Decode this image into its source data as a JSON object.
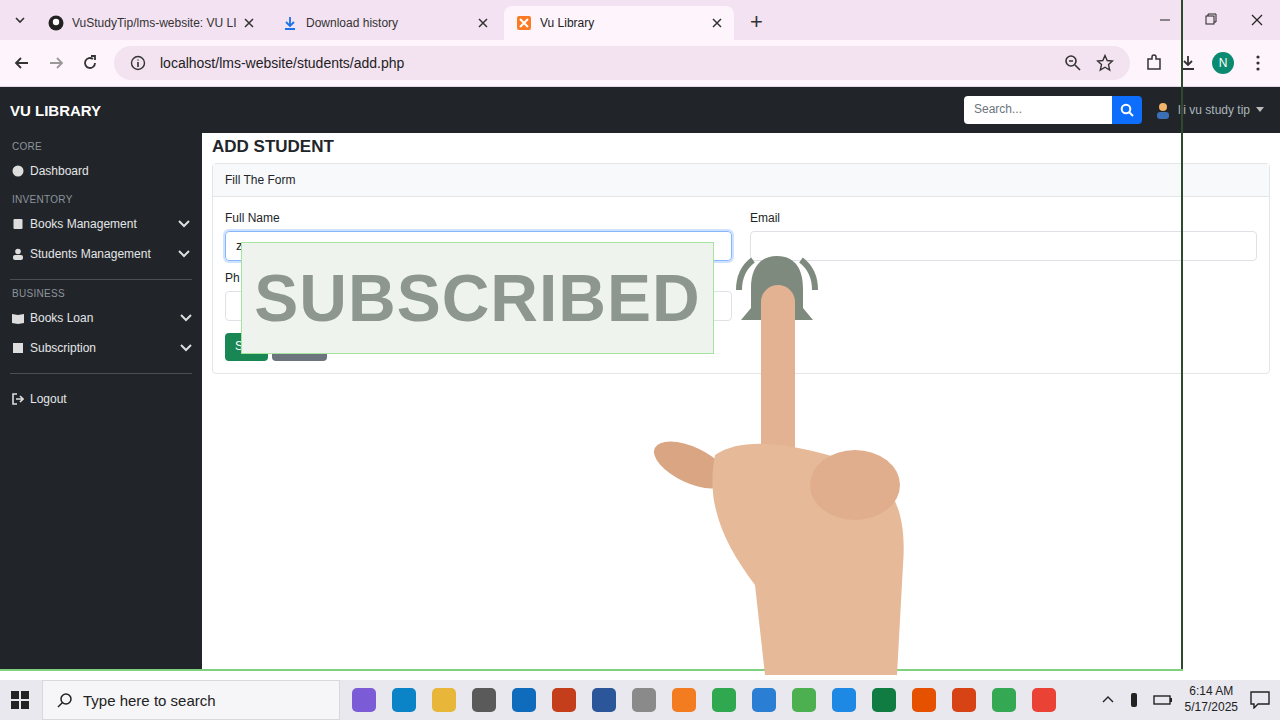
{
  "browser": {
    "tabs": [
      {
        "label": "VuStudyTip/lms-website: VU LI",
        "selected": false
      },
      {
        "label": "Download history",
        "selected": false
      },
      {
        "label": "Vu Library",
        "selected": true
      }
    ],
    "new_tab": "+",
    "address": "localhost/lms-website/students/add.php",
    "profile": "N"
  },
  "navbar": {
    "brand": "VU LIBRARY",
    "search_placeholder": "Search...",
    "user": "lli vu study tip"
  },
  "sidebar": {
    "sections": [
      {
        "heading": "CORE",
        "items": [
          {
            "label": "Dashboard",
            "expandable": false
          }
        ]
      },
      {
        "heading": "INVENTORY",
        "items": [
          {
            "label": "Books Management",
            "expandable": true
          },
          {
            "label": "Students Management",
            "expandable": true
          }
        ]
      },
      {
        "heading": "BUSINESS",
        "items": [
          {
            "label": "Books Loan",
            "expandable": true
          },
          {
            "label": "Subscription",
            "expandable": true
          }
        ]
      }
    ],
    "logout": "Logout"
  },
  "page": {
    "title": "ADD STUDENT",
    "card_header": "Fill The Form",
    "fields": [
      {
        "label": "Full Name",
        "value": "z",
        "focused": true
      },
      {
        "label": "Email",
        "value": "",
        "focused": false
      },
      {
        "label": "Ph",
        "value": "",
        "focused": false
      }
    ],
    "buttons": [
      {
        "label": "S",
        "color": "#198754"
      },
      {
        "label": "",
        "color": "#6c757d"
      }
    ]
  },
  "overlay": {
    "text": "SUBSCRIBED"
  },
  "taskbar": {
    "search_placeholder": "Type here to search",
    "time": "6:14 AM",
    "date": "5/17/2025"
  }
}
